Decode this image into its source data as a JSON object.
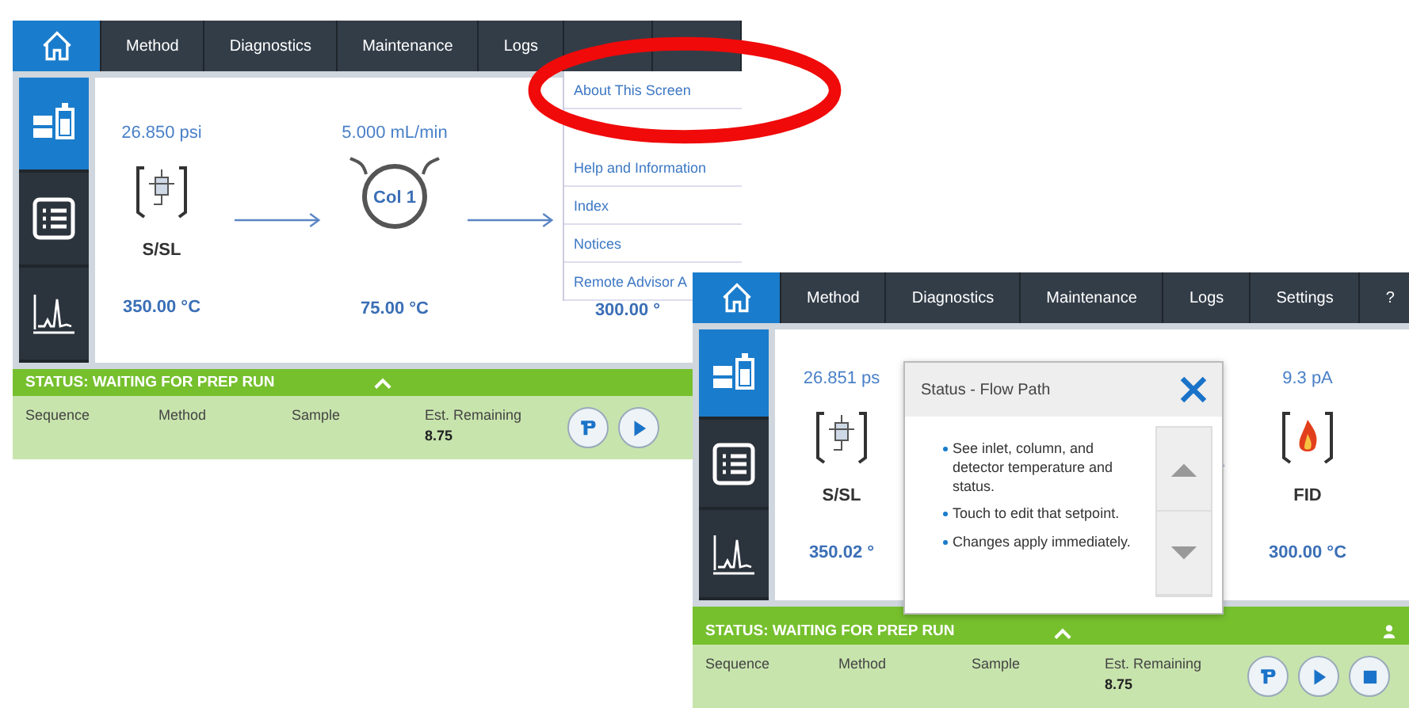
{
  "screens": [
    {
      "nav_tabs": [
        {
          "kind": "home",
          "selected": true
        },
        {
          "kind": "text",
          "label": "Method",
          "selected": false
        },
        {
          "kind": "text",
          "label": "Diagnostics",
          "selected": false
        },
        {
          "kind": "text",
          "label": "Maintenance",
          "selected": false
        },
        {
          "kind": "text",
          "label": "Logs",
          "selected": false
        },
        {
          "kind": "blank",
          "selected": false
        },
        {
          "kind": "blank",
          "selected": false
        }
      ],
      "menu": {
        "items": [
          {
            "label": "About This Screen"
          },
          {
            "label": "Help and Information"
          },
          {
            "label": "Index"
          },
          {
            "label": "Notices"
          },
          {
            "label": "Remote Advisor A"
          }
        ]
      },
      "rail": [
        {
          "kind": "flow",
          "selected": true
        },
        {
          "kind": "list",
          "selected": false
        },
        {
          "kind": "chromatogram",
          "selected": false
        }
      ],
      "flow": [
        {
          "kind": "inlet",
          "top": "26.850 psi",
          "name": "S/SL",
          "temp": "350.00 °C"
        },
        {
          "kind": "column",
          "top": "5.000 mL/min",
          "name": "Col 1",
          "temp": "75.00 °C"
        },
        {
          "kind": "hidden",
          "temp": "300.00 °"
        }
      ],
      "status": {
        "text": "STATUS: WAITING FOR PREP RUN",
        "user_icon": false
      },
      "fields": [
        {
          "label": "Sequence"
        },
        {
          "label": "Method"
        },
        {
          "label": "Sample"
        },
        {
          "label": "Est. Remaining",
          "value": "8.75"
        }
      ],
      "buttons": [
        {
          "kind": "prep"
        },
        {
          "kind": "play"
        }
      ]
    },
    {
      "nav_tabs": [
        {
          "kind": "home",
          "selected": true
        },
        {
          "kind": "text",
          "label": "Method",
          "selected": false
        },
        {
          "kind": "text",
          "label": "Diagnostics",
          "selected": false
        },
        {
          "kind": "text",
          "label": "Maintenance",
          "selected": false
        },
        {
          "kind": "text",
          "label": "Logs",
          "selected": false
        },
        {
          "kind": "text",
          "label": "Settings",
          "selected": false
        },
        {
          "kind": "text",
          "label": "?",
          "selected": false
        }
      ],
      "rail": [
        {
          "kind": "flow",
          "selected": true
        },
        {
          "kind": "list",
          "selected": false
        },
        {
          "kind": "chromatogram",
          "selected": false
        }
      ],
      "flow": [
        {
          "kind": "inlet",
          "top": "26.851 ps",
          "name": "S/SL",
          "temp": "350.02 °"
        },
        {
          "kind": "detector",
          "top": "9.3 pA",
          "name": "FID",
          "temp": "300.00 °C"
        }
      ],
      "popup": {
        "title": "Status - Flow Path",
        "bullets": [
          "See inlet, column, and detector temperature and status.",
          "Touch to edit that setpoint.",
          "Changes apply immediately."
        ]
      },
      "status": {
        "text": "STATUS: WAITING FOR PREP RUN",
        "user_icon": true
      },
      "fields": [
        {
          "label": "Sequence"
        },
        {
          "label": "Method"
        },
        {
          "label": "Sample"
        },
        {
          "label": "Est. Remaining",
          "value": "8.75"
        }
      ],
      "buttons": [
        {
          "kind": "prep"
        },
        {
          "kind": "play"
        },
        {
          "kind": "stop"
        }
      ]
    }
  ]
}
